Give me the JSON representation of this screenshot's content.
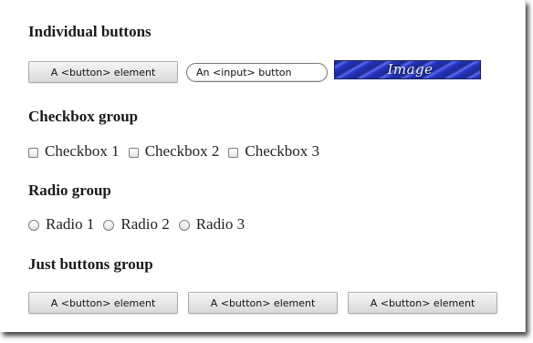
{
  "individual": {
    "heading": "Individual buttons",
    "button_label": "A <button> element",
    "input_button_label": "An <input> button",
    "image_button_label": "Image"
  },
  "checkbox_group": {
    "heading": "Checkbox group",
    "items": [
      "Checkbox 1",
      "Checkbox 2",
      "Checkbox 3"
    ]
  },
  "radio_group": {
    "heading": "Radio group",
    "items": [
      "Radio 1",
      "Radio 2",
      "Radio 3"
    ]
  },
  "buttons_group": {
    "heading": "Just buttons group",
    "items": [
      "A <button> element",
      "A <button> element",
      "A <button> element"
    ]
  },
  "colors": {
    "image_button": "#2a3bd0",
    "button_face": "#e6e6e6",
    "shadow": "#000000"
  }
}
